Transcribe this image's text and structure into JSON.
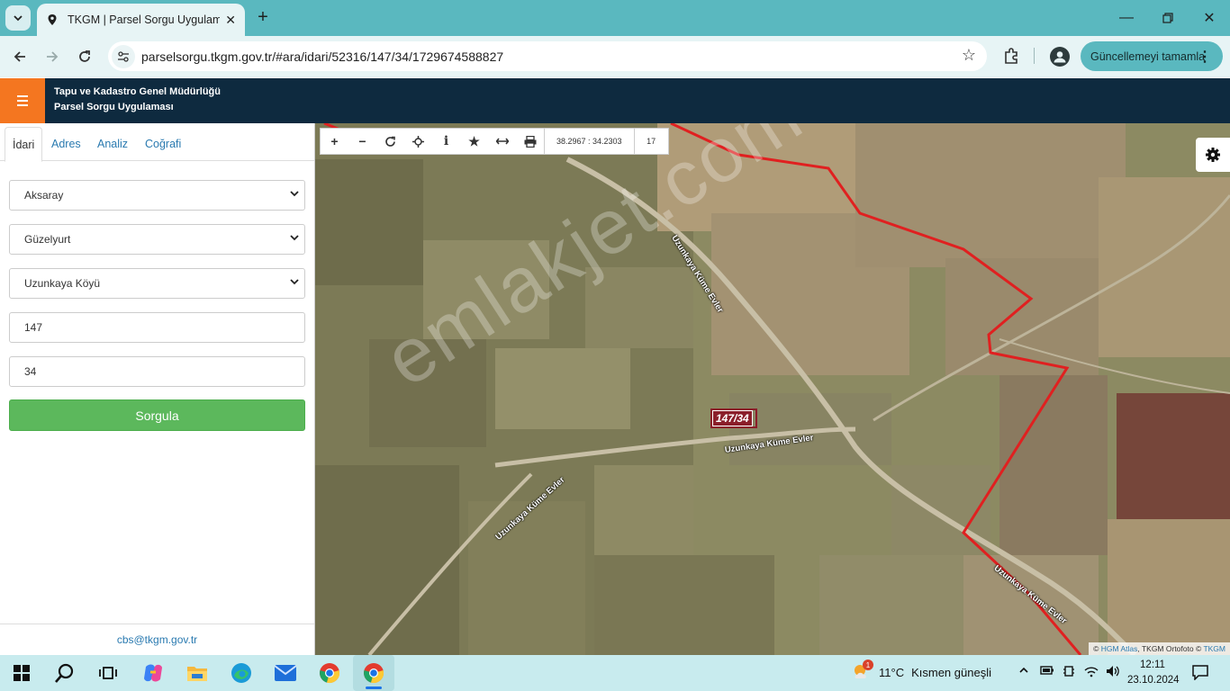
{
  "browser": {
    "tab_title": "TKGM | Parsel Sorgu Uygulaması",
    "url": "parselsorgu.tkgm.gov.tr/#ara/idari/52316/147/34/1729674588827",
    "update_label": "Güncellemeyi tamamla"
  },
  "app": {
    "org_name": "Tapu ve Kadastro Genel Müdürlüğü",
    "app_name": "Parsel Sorgu Uygulaması",
    "accent_color": "#f47620",
    "header_color": "#0e2a3f"
  },
  "sidebar": {
    "tabs": [
      {
        "label": "İdari",
        "active": true
      },
      {
        "label": "Adres",
        "active": false
      },
      {
        "label": "Analiz",
        "active": false
      },
      {
        "label": "Coğrafi",
        "active": false
      }
    ],
    "province": "Aksaray",
    "district": "Güzelyurt",
    "neighborhood": "Uzunkaya Köyü",
    "block": "147",
    "parcel": "34",
    "query_button": "Sorgula",
    "footer_email": "cbs@tkgm.gov.tr"
  },
  "map": {
    "coordinates": "38.2967 : 34.2303",
    "zoom": "17",
    "parcel_label": "147/34",
    "watermark": "emlakjet.com",
    "road_labels": [
      "Uzunkaya Küme Evler",
      "Uzunkaya Küme Evler",
      "Uzunkaya Küme Evler",
      "Uzunkaya Küme Evler"
    ],
    "attribution_prefix": "©",
    "attribution_hgm": "HGM Atlas",
    "attribution_mid": ", TKGM Ortofoto ©",
    "attribution_tkgm": "TKGM",
    "tools": [
      "zoom-in-icon",
      "zoom-out-icon",
      "refresh-icon",
      "locate-icon",
      "info-icon",
      "favorite-icon",
      "measure-icon",
      "print-icon"
    ]
  },
  "taskbar": {
    "temperature": "11°C",
    "weather_text": "Kısmen güneşli",
    "weather_badge": "1",
    "time": "12:11",
    "date": "23.10.2024"
  }
}
